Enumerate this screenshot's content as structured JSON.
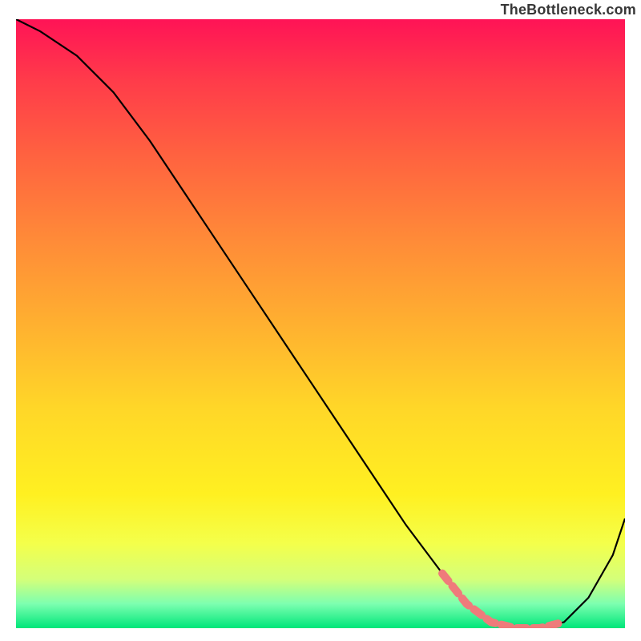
{
  "watermark": "TheBottleneck.com",
  "chart_data": {
    "type": "line",
    "title": "",
    "xlabel": "",
    "ylabel": "",
    "xlim": [
      0,
      100
    ],
    "ylim": [
      0,
      100
    ],
    "grid": false,
    "series": [
      {
        "name": "curve",
        "color": "#000000",
        "x": [
          0,
          4,
          10,
          16,
          22,
          28,
          34,
          40,
          46,
          52,
          58,
          64,
          70,
          74,
          78,
          82,
          86,
          90,
          94,
          98,
          100
        ],
        "y": [
          100,
          98,
          94,
          88,
          80,
          71,
          62,
          53,
          44,
          35,
          26,
          17,
          9,
          4,
          1,
          0,
          0,
          1,
          5,
          12,
          18
        ]
      },
      {
        "name": "highlight-band",
        "color": "#ef7b7b",
        "x": [
          70,
          74,
          78,
          82,
          86,
          90
        ],
        "y": [
          9,
          4,
          1,
          0,
          0,
          1
        ]
      }
    ],
    "gradient_stops": [
      {
        "pos": 0,
        "color": "#ff1356"
      },
      {
        "pos": 10,
        "color": "#ff3b4a"
      },
      {
        "pos": 22,
        "color": "#ff6140"
      },
      {
        "pos": 36,
        "color": "#ff8a38"
      },
      {
        "pos": 50,
        "color": "#ffb030"
      },
      {
        "pos": 64,
        "color": "#ffd728"
      },
      {
        "pos": 78,
        "color": "#fff021"
      },
      {
        "pos": 86,
        "color": "#f4ff4a"
      },
      {
        "pos": 92,
        "color": "#d4ff7a"
      },
      {
        "pos": 96,
        "color": "#7dffb0"
      },
      {
        "pos": 100,
        "color": "#00e67a"
      }
    ]
  }
}
